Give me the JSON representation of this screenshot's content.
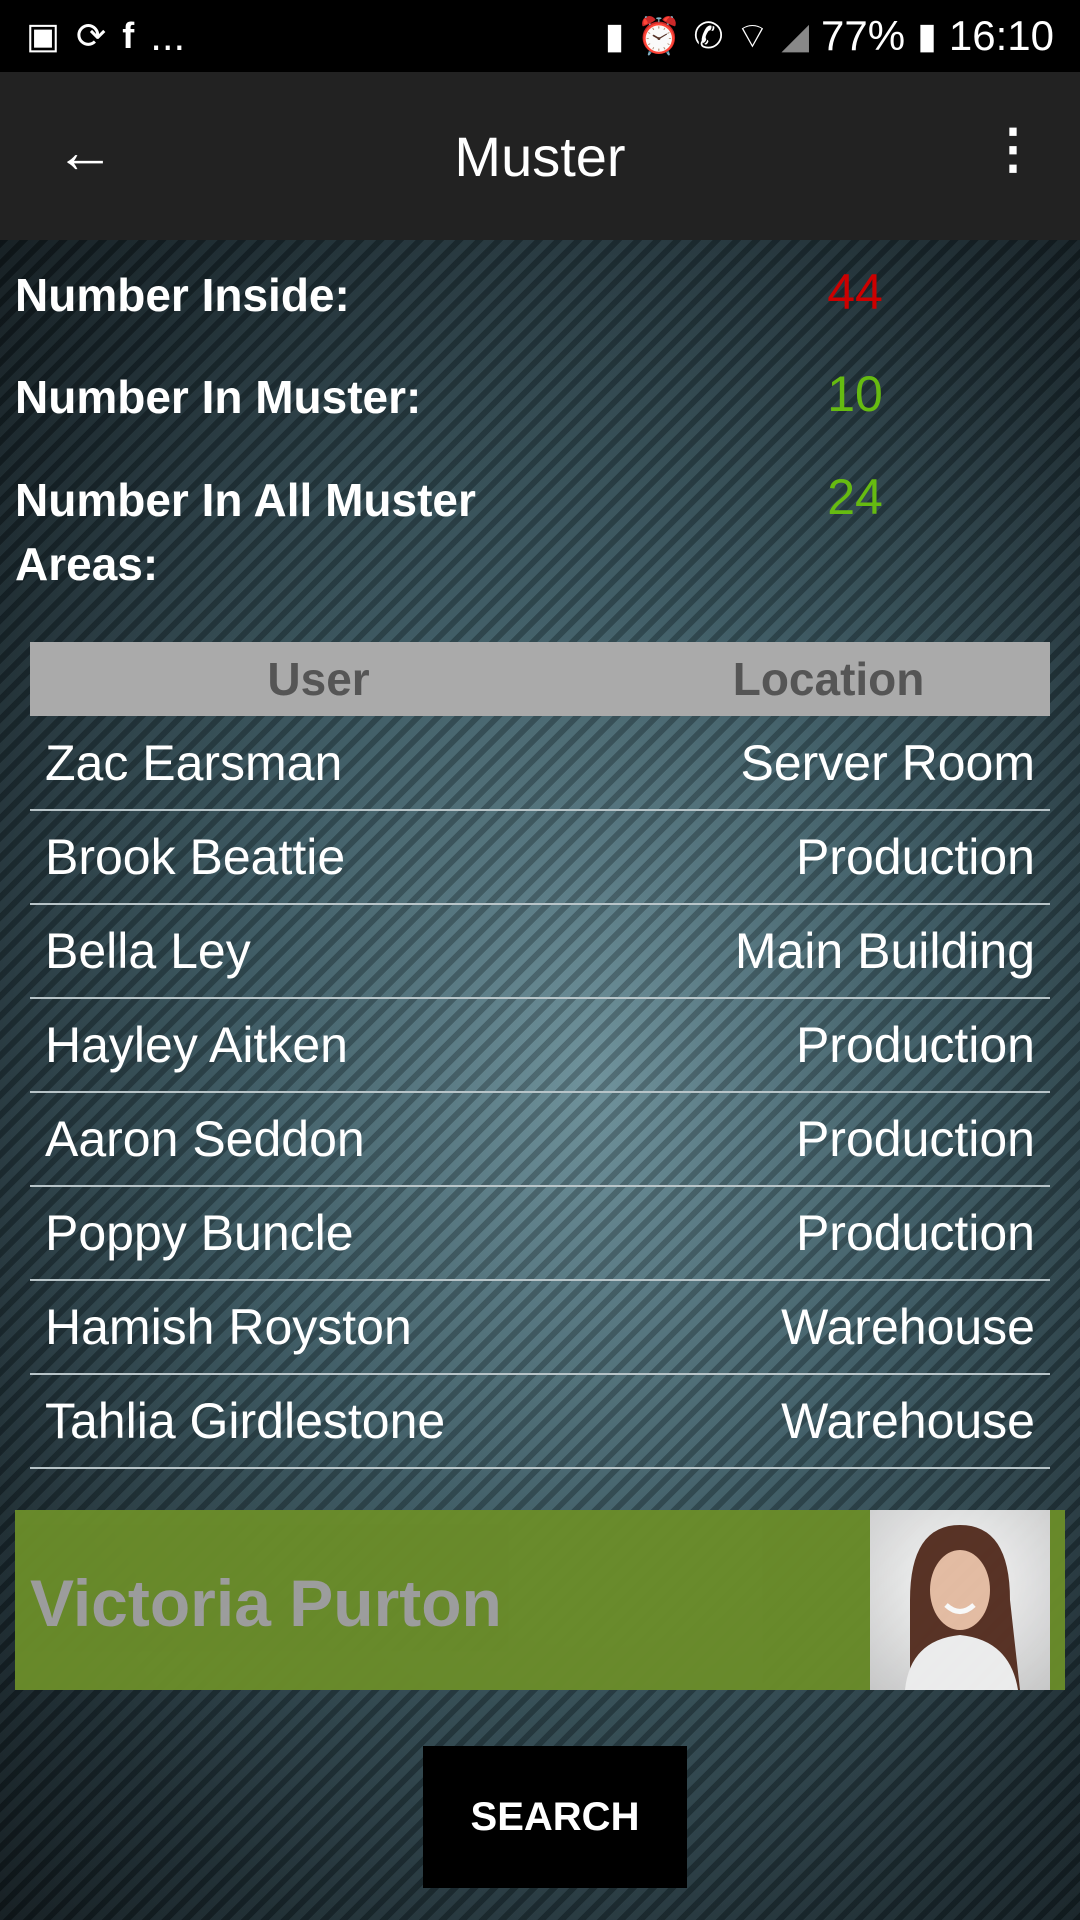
{
  "status_bar": {
    "left_icons": [
      "image-icon",
      "sync-icon",
      "facebook-icon",
      "more-notifications-icon"
    ],
    "more": "...",
    "right_icons": [
      "battery-saver-icon",
      "alarm-icon",
      "wifi-call-icon",
      "wifi-icon",
      "signal-icon"
    ],
    "battery": "77%",
    "time": "16:10"
  },
  "appbar": {
    "title": "Muster",
    "back_icon": "arrow-left-icon",
    "menu_icon": "more-vert-icon"
  },
  "stats": [
    {
      "label": "Number Inside:",
      "value": "44",
      "color": "#cc0000"
    },
    {
      "label": "Number In Muster:",
      "value": "10",
      "color": "#66bb11"
    },
    {
      "label": "Number In All Muster Areas:",
      "value": "24",
      "color": "#66bb11"
    }
  ],
  "table": {
    "headers": [
      "User",
      "Location"
    ],
    "rows": [
      [
        "Zac Earsman",
        "Server Room"
      ],
      [
        "Brook Beattie",
        "Production"
      ],
      [
        "Bella Ley",
        "Main Building"
      ],
      [
        "Hayley Aitken",
        "Production"
      ],
      [
        "Aaron Seddon",
        "Production"
      ],
      [
        "Poppy Buncle",
        "Production"
      ],
      [
        "Hamish Royston",
        "Warehouse"
      ],
      [
        "Tahlia Girdlestone",
        "Warehouse"
      ]
    ]
  },
  "current_user": {
    "name": "Victoria Purton",
    "banner_color": "#6a8c2a"
  },
  "search_label": "SEARCH"
}
